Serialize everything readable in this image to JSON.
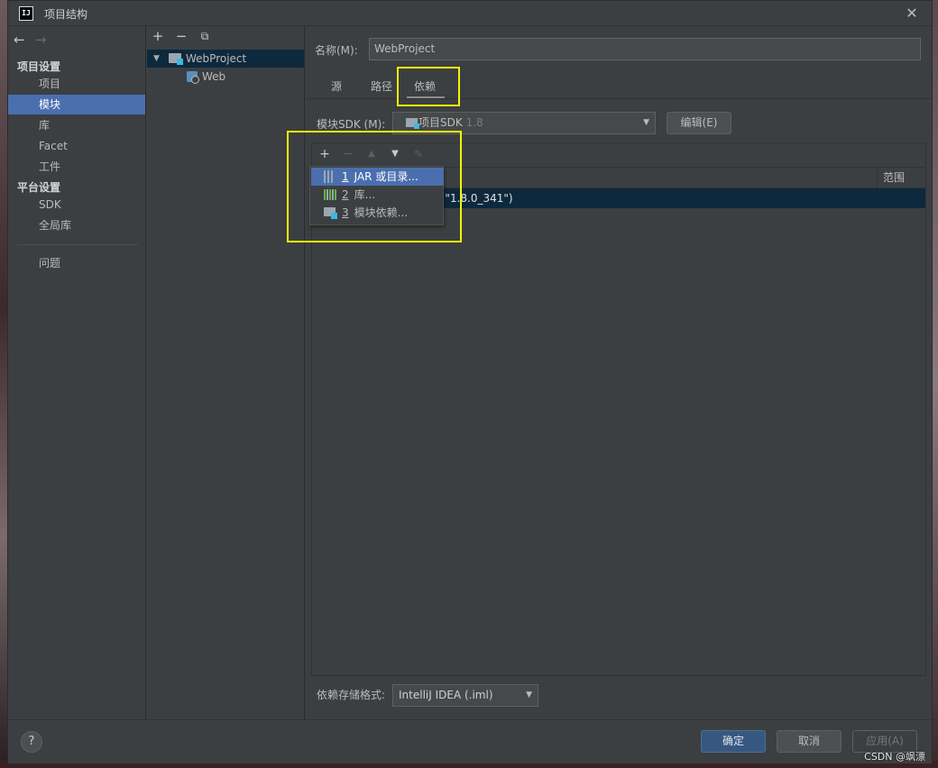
{
  "window": {
    "title": "项目结构",
    "logo_text": "IJ"
  },
  "nav": {
    "back_glyph": "←",
    "forward_glyph": "→",
    "section_project": "项目设置",
    "section_platform": "平台设置",
    "items_project": [
      "项目",
      "模块",
      "库",
      "Facet",
      "工件"
    ],
    "items_platform": [
      "SDK",
      "全局库"
    ],
    "problems": "问题",
    "selected": "模块"
  },
  "tree": {
    "root": "WebProject",
    "child": "Web"
  },
  "main": {
    "name_label": "名称(M):",
    "name_value": "WebProject",
    "tabs": [
      "源",
      "路径",
      "依赖"
    ],
    "active_tab": "依赖",
    "sdk_label": "模块SDK (M):",
    "sdk_value": "项目SDK",
    "sdk_version": "1.8",
    "edit_button": "编辑(E)",
    "scope_header": "范围",
    "dep_row_text": "n \"1.8.0_341\")",
    "storage_label": "依赖存储格式:",
    "storage_value": "IntelliJ IDEA (.iml)"
  },
  "popup": {
    "items": [
      {
        "num": "1",
        "label": "JAR 或目录...",
        "icon": "jar-icon"
      },
      {
        "num": "2",
        "label": "库...",
        "icon": "library-icon"
      },
      {
        "num": "3",
        "label": "模块依赖...",
        "icon": "module-icon"
      }
    ]
  },
  "footer": {
    "help": "?",
    "ok": "确定",
    "cancel": "取消",
    "apply": "应用(A)",
    "watermark": "CSDN @飒漂"
  },
  "colors": {
    "highlight": "#f5f500",
    "selection": "#4b6eaf",
    "row_selection": "#0d293e",
    "ok_button": "#365880"
  }
}
